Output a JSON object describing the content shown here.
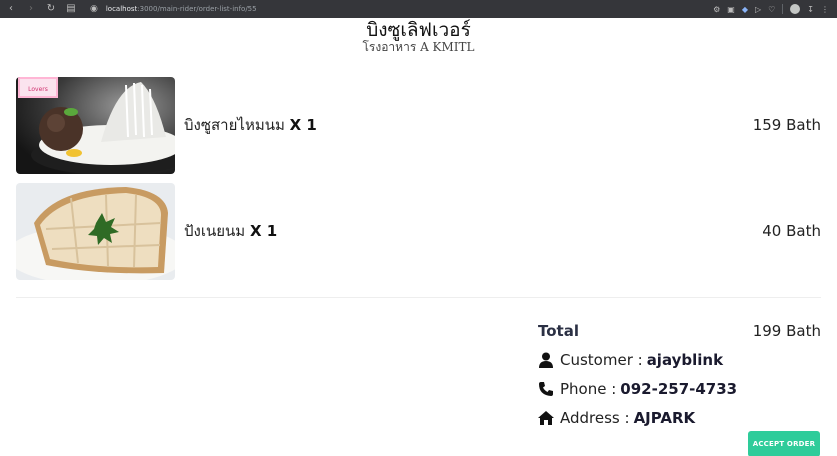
{
  "browser": {
    "url_host": "localhost",
    "url_rest": ":3000/main-rider/order-list-info/55"
  },
  "header": {
    "title": "บิงซูเลิฟเวอร์",
    "subtitle": "โรงอาหาร A KMITL"
  },
  "items": [
    {
      "name": "บิงซูสายไหมนม",
      "qty": "X 1",
      "price": "159 Bath",
      "image_label": "Lovers"
    },
    {
      "name": "ปังเนยนม",
      "qty": "X 1",
      "price": "40 Bath"
    }
  ],
  "summary": {
    "total_label": "Total",
    "total_value": "199 Bath",
    "customer_label": "Customer :",
    "customer_value": "ajayblink",
    "phone_label": "Phone :",
    "phone_value": "092-257-4733",
    "address_label": "Address :",
    "address_value": "AJPARK"
  },
  "actions": {
    "accept_label": "ACCEPT ORDER"
  },
  "colors": {
    "accent": "#2ecc9a",
    "browser_bar": "#35363a"
  }
}
